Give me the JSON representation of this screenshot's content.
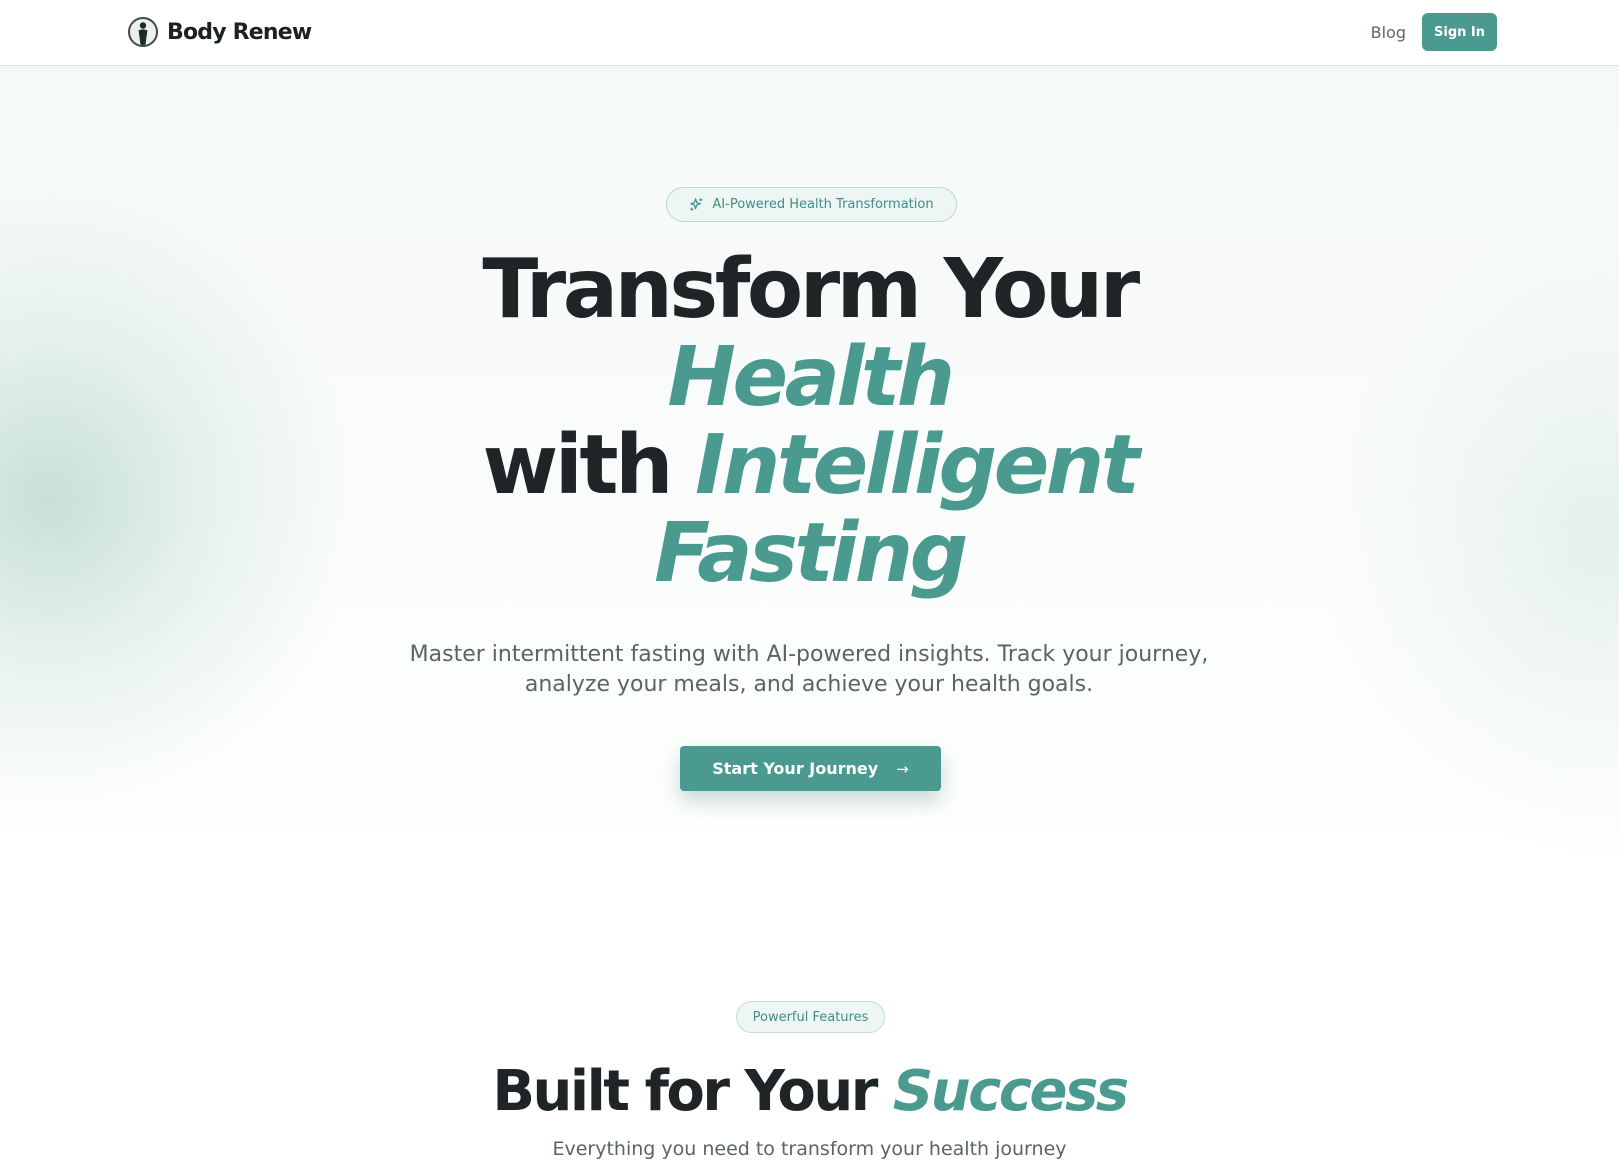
{
  "header": {
    "brand_name": "Body Renew",
    "nav_blog": "Blog",
    "sign_in": "Sign In"
  },
  "hero": {
    "badge": "AI-Powered Health Transformation",
    "title_line1": "Transform Your",
    "title_accent1": "Health",
    "title_with": "with ",
    "title_accent2": "Intelligent",
    "title_accent3": "Fasting",
    "subtitle": "Master intermittent fasting with AI-powered insights. Track your journey, analyze your meals, and achieve your health goals.",
    "cta": "Start Your Journey",
    "cta_icon": "arrow-right-icon"
  },
  "features": {
    "badge": "Powerful Features",
    "title": "Built for Your ",
    "title_accent": "Success",
    "subtitle": "Everything you need to transform your health journey"
  },
  "colors": {
    "accent": "#4a9a8f",
    "text_dark": "#1f2426",
    "text_muted": "#596466",
    "pill_bg": "#eef6f4"
  }
}
